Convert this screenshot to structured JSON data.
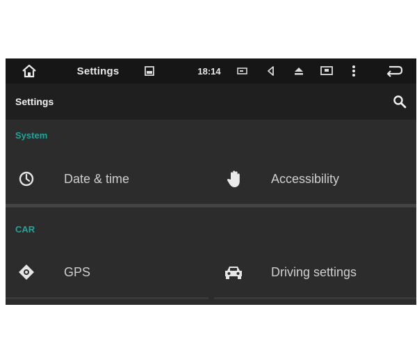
{
  "status_bar": {
    "title": "Settings",
    "time": "18:14",
    "icons": [
      "home-icon",
      "gallery-icon",
      "battery-icon",
      "volume-icon",
      "eject-icon",
      "screen-icon",
      "more-vert-icon",
      "back-icon"
    ]
  },
  "action_bar": {
    "title": "Settings",
    "search_icon": "search-icon"
  },
  "sections": [
    {
      "header": "System",
      "items": [
        {
          "label": "Date & time",
          "icon": "clock-icon"
        },
        {
          "label": "Accessibility",
          "icon": "hand-icon"
        }
      ]
    },
    {
      "header": "CAR",
      "items": [
        {
          "label": "GPS",
          "icon": "gps-icon"
        },
        {
          "label": "Driving settings",
          "icon": "car-icon"
        }
      ]
    }
  ],
  "colors": {
    "status_bar_bg": "#161616",
    "action_bar_bg": "#1f1f1f",
    "content_bg": "#2c2c2c",
    "section_header": "#1fa79b",
    "item_text": "#cfcfcf"
  }
}
